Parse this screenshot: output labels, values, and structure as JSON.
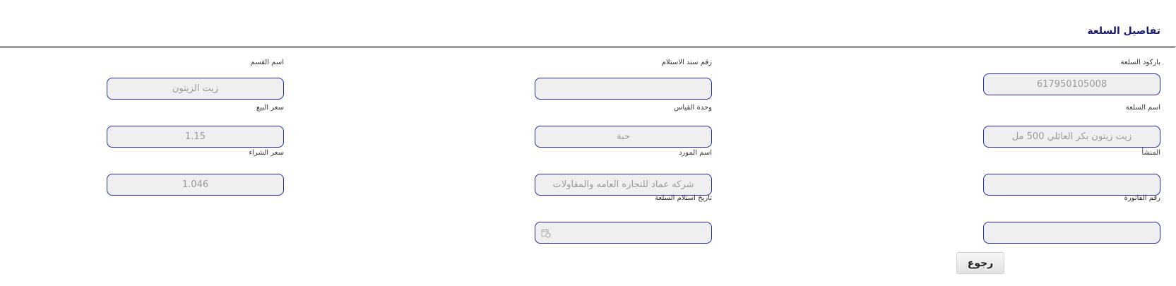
{
  "page": {
    "title": "تفاصيل السلعة"
  },
  "fields": {
    "barcode": {
      "label": "باركود السلعة",
      "value": "617950105008"
    },
    "item_name": {
      "label": "اسم السلعة",
      "value": "زيت زيتون بكر العائلي  500 مل"
    },
    "origin": {
      "label": "المنشأ",
      "value": ""
    },
    "invoice_number": {
      "label": "رقم الفاتورة",
      "value": ""
    },
    "receipt_number": {
      "label": "رقم سند الاستلام",
      "value": ""
    },
    "unit": {
      "label": "وحدة القياس",
      "value": "حبة"
    },
    "supplier": {
      "label": "اسم المورد",
      "value": "شركه عماد للتجاره العامه والمقاولات"
    },
    "receipt_date": {
      "label": "تاريخ استلام السلعة",
      "value": "",
      "icon": "calendar-icon"
    },
    "department": {
      "label": "اسم القسم",
      "value": "زيت الزيتون"
    },
    "sale_price": {
      "label": "سعر البيع",
      "value": "1.15"
    },
    "purchase_price": {
      "label": "سعر الشراء",
      "value": "1.046"
    }
  },
  "actions": {
    "back_label": "رجوع"
  },
  "colors": {
    "field_border": "#1e2aa8",
    "title": "#1a1a70",
    "field_bg": "#efefef"
  }
}
